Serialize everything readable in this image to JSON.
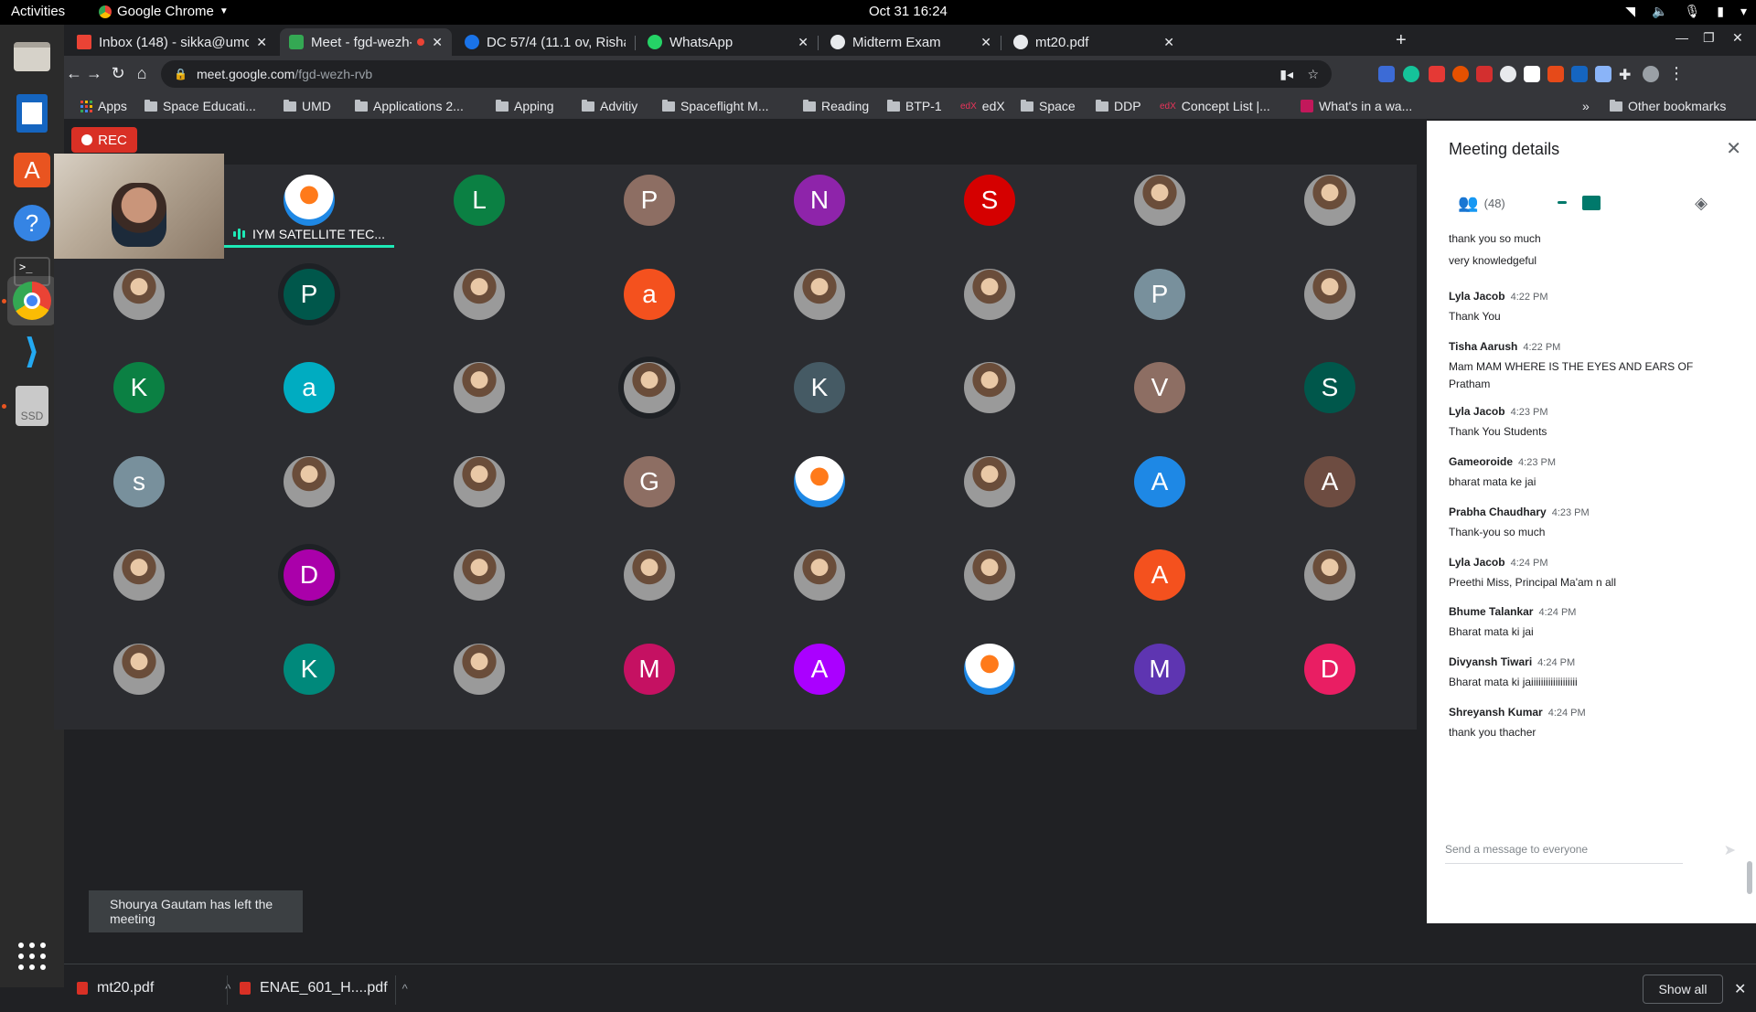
{
  "ubuntu": {
    "activities": "Activities",
    "app_menu": "Google Chrome",
    "clock": "Oct 31  16:24"
  },
  "dock": {
    "items": [
      "files",
      "writer",
      "software-center",
      "help",
      "terminal",
      "chrome",
      "vscode",
      "ssd"
    ],
    "ssd_label": "SSD"
  },
  "tabs": [
    {
      "label": "Inbox (148) - sikka@umd.",
      "color": "#ea4335",
      "active": false
    },
    {
      "label": "Meet - fgd-wezh-rvb",
      "color": "#34a853",
      "active": true
    },
    {
      "label": "DC 57/4 (11.1 ov, Rishabh",
      "color": "#1a73e8",
      "active": false
    },
    {
      "label": "WhatsApp",
      "color": "#25d366",
      "active": false
    },
    {
      "label": "Midterm Exam",
      "color": "#e8eaed",
      "active": false
    },
    {
      "label": "mt20.pdf",
      "color": "#e8eaed",
      "active": false
    }
  ],
  "omnibox": {
    "host": "meet.google.com",
    "path": "/fgd-wezh-rvb"
  },
  "bookmarks": [
    {
      "label": "Apps",
      "type": "apps"
    },
    {
      "label": "Space Educati...",
      "type": "folder"
    },
    {
      "label": "UMD",
      "type": "folder"
    },
    {
      "label": "Applications 2...",
      "type": "folder"
    },
    {
      "label": "Apping",
      "type": "folder"
    },
    {
      "label": "Advitiy",
      "type": "folder"
    },
    {
      "label": "Spaceflight M...",
      "type": "folder"
    },
    {
      "label": "Reading",
      "type": "folder"
    },
    {
      "label": "BTP-1",
      "type": "folder"
    },
    {
      "label": "edX",
      "type": "site"
    },
    {
      "label": "Space",
      "type": "folder"
    },
    {
      "label": "DDP",
      "type": "folder"
    },
    {
      "label": "Concept List |...",
      "type": "site"
    },
    {
      "label": "What's in a wa...",
      "type": "site"
    }
  ],
  "bookmarks_other": "Other bookmarks",
  "meet": {
    "rec_label": "REC",
    "speaker_name": "IYM SATELLITE TEC...",
    "toast": "Shourya Gautam has left the meeting",
    "participants": [
      {
        "kind": "video"
      },
      {
        "kind": "logo"
      },
      {
        "letter": "L",
        "color": "#0b8043"
      },
      {
        "letter": "P",
        "color": "#8d6e63"
      },
      {
        "letter": "N",
        "color": "#8e24aa"
      },
      {
        "letter": "S",
        "color": "#d50000"
      },
      {
        "kind": "photo"
      },
      {
        "kind": "photo"
      },
      {
        "kind": "photo"
      },
      {
        "letter": "P",
        "color": "#00574b",
        "ring": true
      },
      {
        "kind": "photo"
      },
      {
        "letter": "a",
        "color": "#f4511e"
      },
      {
        "kind": "photo"
      },
      {
        "kind": "photo"
      },
      {
        "letter": "P",
        "color": "#78909c"
      },
      {
        "kind": "photo"
      },
      {
        "letter": "K",
        "color": "#0b8043"
      },
      {
        "letter": "a",
        "color": "#00acc1"
      },
      {
        "kind": "photo"
      },
      {
        "kind": "photo",
        "ring": true
      },
      {
        "letter": "K",
        "color": "#455a64"
      },
      {
        "kind": "photo"
      },
      {
        "letter": "V",
        "color": "#8d6e63"
      },
      {
        "letter": "S",
        "color": "#00574b"
      },
      {
        "letter": "s",
        "color": "#78909c"
      },
      {
        "kind": "photo"
      },
      {
        "kind": "photo"
      },
      {
        "letter": "G",
        "color": "#8d6e63"
      },
      {
        "kind": "logo"
      },
      {
        "kind": "photo"
      },
      {
        "letter": "A",
        "color": "#1e88e5"
      },
      {
        "letter": "A",
        "color": "#6d4c41"
      },
      {
        "kind": "photo"
      },
      {
        "letter": "D",
        "color": "#aa00aa",
        "ring": true
      },
      {
        "kind": "photo"
      },
      {
        "kind": "photo"
      },
      {
        "kind": "photo"
      },
      {
        "kind": "photo"
      },
      {
        "letter": "A",
        "color": "#f4511e"
      },
      {
        "kind": "photo"
      },
      {
        "kind": "photo"
      },
      {
        "letter": "K",
        "color": "#00897b"
      },
      {
        "kind": "photo"
      },
      {
        "letter": "M",
        "color": "#c51162"
      },
      {
        "letter": "A",
        "color": "#aa00ff"
      },
      {
        "kind": "logo"
      },
      {
        "letter": "M",
        "color": "#5e35b1"
      },
      {
        "letter": "D",
        "color": "#e91e63"
      }
    ]
  },
  "panel": {
    "title": "Meeting details",
    "people_count": "(48)",
    "compose_placeholder": "Send a message to everyone",
    "messages": [
      {
        "who": "",
        "time": "",
        "text": "thank you so much"
      },
      {
        "who": "",
        "time": "",
        "text": "very knowledgeful"
      },
      {
        "who": "Lyla Jacob",
        "time": "4:22 PM",
        "text": "Thank You"
      },
      {
        "who": "Tisha Aarush",
        "time": "4:22 PM",
        "text": "Mam MAM WHERE IS THE  EYES AND EARS OF Pratham"
      },
      {
        "who": "Lyla Jacob",
        "time": "4:23 PM",
        "text": "Thank You Students"
      },
      {
        "who": "Gameoroide",
        "time": "4:23 PM",
        "text": "bharat mata ke jai"
      },
      {
        "who": "Prabha Chaudhary",
        "time": "4:23 PM",
        "text": "Thank-you so much"
      },
      {
        "who": "Lyla Jacob",
        "time": "4:24 PM",
        "text": "Preethi Miss, Principal Ma'am n all"
      },
      {
        "who": "Bhume Talankar",
        "time": "4:24 PM",
        "text": "Bharat mata ki jai"
      },
      {
        "who": "Divyansh Tiwari",
        "time": "4:24 PM",
        "text": "Bharat mata ki jaiiiiiiiiiiiiiiiiiii"
      },
      {
        "who": "Shreyansh Kumar",
        "time": "4:24 PM",
        "text": "thank you thacher"
      }
    ]
  },
  "downloads": {
    "items": [
      "mt20.pdf",
      "ENAE_601_H....pdf"
    ],
    "show_all": "Show all"
  }
}
